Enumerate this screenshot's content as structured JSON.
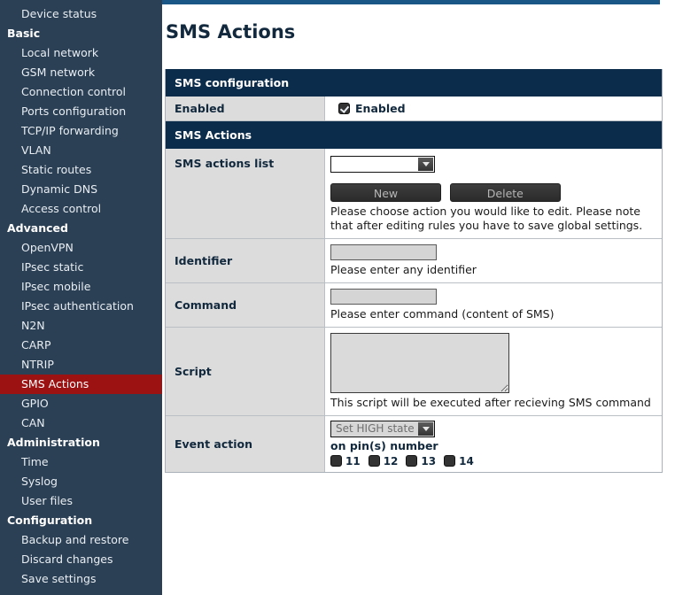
{
  "sidebar": {
    "items": [
      {
        "label": "Device status",
        "type": "item",
        "active": false
      },
      {
        "label": "Basic",
        "type": "group",
        "active": false
      },
      {
        "label": "Local network",
        "type": "item",
        "active": false
      },
      {
        "label": "GSM network",
        "type": "item",
        "active": false
      },
      {
        "label": "Connection control",
        "type": "item",
        "active": false
      },
      {
        "label": "Ports configuration",
        "type": "item",
        "active": false
      },
      {
        "label": "TCP/IP forwarding",
        "type": "item",
        "active": false
      },
      {
        "label": "VLAN",
        "type": "item",
        "active": false
      },
      {
        "label": "Static routes",
        "type": "item",
        "active": false
      },
      {
        "label": "Dynamic DNS",
        "type": "item",
        "active": false
      },
      {
        "label": "Access control",
        "type": "item",
        "active": false
      },
      {
        "label": "Advanced",
        "type": "group",
        "active": false
      },
      {
        "label": "OpenVPN",
        "type": "item",
        "active": false
      },
      {
        "label": "IPsec static",
        "type": "item",
        "active": false
      },
      {
        "label": "IPsec mobile",
        "type": "item",
        "active": false
      },
      {
        "label": "IPsec authentication",
        "type": "item",
        "active": false
      },
      {
        "label": "N2N",
        "type": "item",
        "active": false
      },
      {
        "label": "CARP",
        "type": "item",
        "active": false
      },
      {
        "label": "NTRIP",
        "type": "item",
        "active": false
      },
      {
        "label": "SMS Actions",
        "type": "item",
        "active": true
      },
      {
        "label": "GPIO",
        "type": "item",
        "active": false
      },
      {
        "label": "CAN",
        "type": "item",
        "active": false
      },
      {
        "label": "Administration",
        "type": "group",
        "active": false
      },
      {
        "label": "Time",
        "type": "item",
        "active": false
      },
      {
        "label": "Syslog",
        "type": "item",
        "active": false
      },
      {
        "label": "User files",
        "type": "item",
        "active": false
      },
      {
        "label": "Configuration",
        "type": "group",
        "active": false
      },
      {
        "label": "Backup and restore",
        "type": "item",
        "active": false
      },
      {
        "label": "Discard changes",
        "type": "item",
        "active": false
      },
      {
        "label": "Save settings",
        "type": "item",
        "active": false
      }
    ]
  },
  "page": {
    "title": "SMS Actions"
  },
  "sms_configuration": {
    "header": "SMS configuration",
    "enabled_row_label": "Enabled",
    "enabled_checkbox_label": "Enabled",
    "enabled_checked": true
  },
  "sms_actions": {
    "header": "SMS Actions",
    "actions_list": {
      "label": "SMS actions list",
      "selected": "",
      "options": []
    },
    "buttons": {
      "new_label": "New",
      "delete_label": "Delete",
      "hint": "Please choose action you would like to edit. Please note that after editing rules you have to save global settings."
    },
    "identifier": {
      "label": "Identifier",
      "value": "",
      "hint": "Please enter any identifier"
    },
    "command": {
      "label": "Command",
      "value": "",
      "hint": "Please enter command (content of SMS)"
    },
    "script": {
      "label": "Script",
      "value": "",
      "hint": "This script will be executed after recieving SMS command"
    },
    "event_action": {
      "label": "Event action",
      "selected": "Set HIGH state",
      "pins_label": "on pin(s) number",
      "pins": [
        {
          "number": "11",
          "checked": false
        },
        {
          "number": "12",
          "checked": false
        },
        {
          "number": "13",
          "checked": false
        },
        {
          "number": "14",
          "checked": false
        }
      ]
    }
  },
  "colors": {
    "sidebar_bg": "#2b4055",
    "topbar": "#1b5786",
    "section_header": "#0c2c4b",
    "active_item": "#9c1111",
    "label_cell": "#dcdcdc"
  }
}
